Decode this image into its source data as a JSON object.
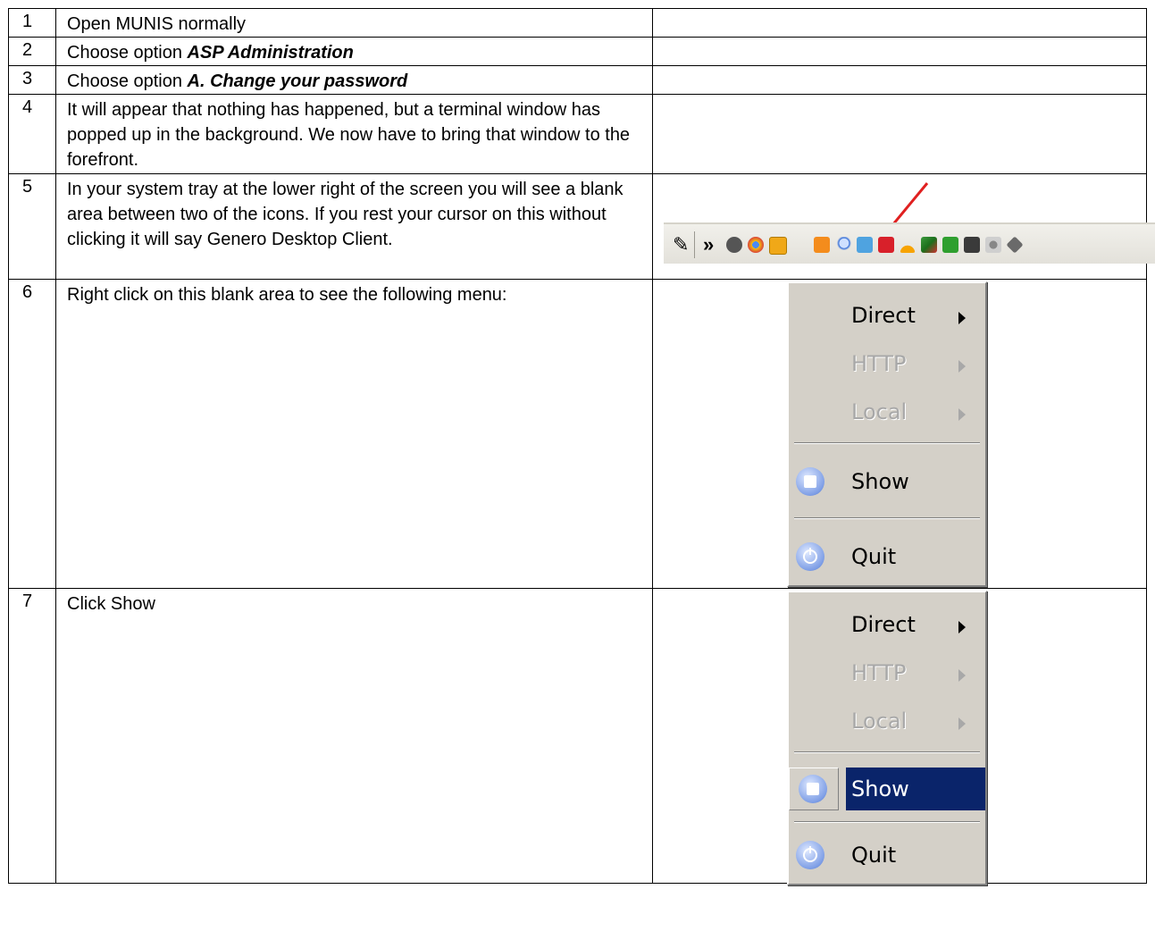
{
  "rows": [
    {
      "num": "1",
      "text": "Open MUNIS normally"
    },
    {
      "num": "2",
      "prefix": "Choose option ",
      "emphasis": "ASP Administration"
    },
    {
      "num": "3",
      "prefix": "Choose option ",
      "emphasis": "A. Change your password"
    },
    {
      "num": "4",
      "text": "It will appear that nothing has happened, but a terminal window has popped up in the background. We now have to bring that window to the forefront."
    },
    {
      "num": "5",
      "text": "In your system tray at the lower right of the screen you will see a blank area between two of the icons. If you rest your cursor on this without clicking it will say Genero Desktop Client."
    },
    {
      "num": "6",
      "text": "Right click on this blank area to see the following menu:"
    },
    {
      "num": "7",
      "text": "Click Show"
    }
  ],
  "menu": {
    "direct": "Direct",
    "http": "HTTP",
    "local": "Local",
    "show": "Show",
    "quit": "Quit"
  },
  "tray": {
    "chevron": "»",
    "icons": [
      "pen-icon",
      "m-icon",
      "chrome-icon",
      "o-icon",
      "genero-icon",
      "search-icon",
      "network-icon",
      "pdf-icon",
      "wifi-icon",
      "tool-icon",
      "green-icon",
      "monitor-icon",
      "key-icon",
      "diamond-icon"
    ]
  },
  "colors": {
    "highlight": "#0a246a",
    "menu_bg": "#d4d0c8",
    "arrow": "#e02020"
  }
}
